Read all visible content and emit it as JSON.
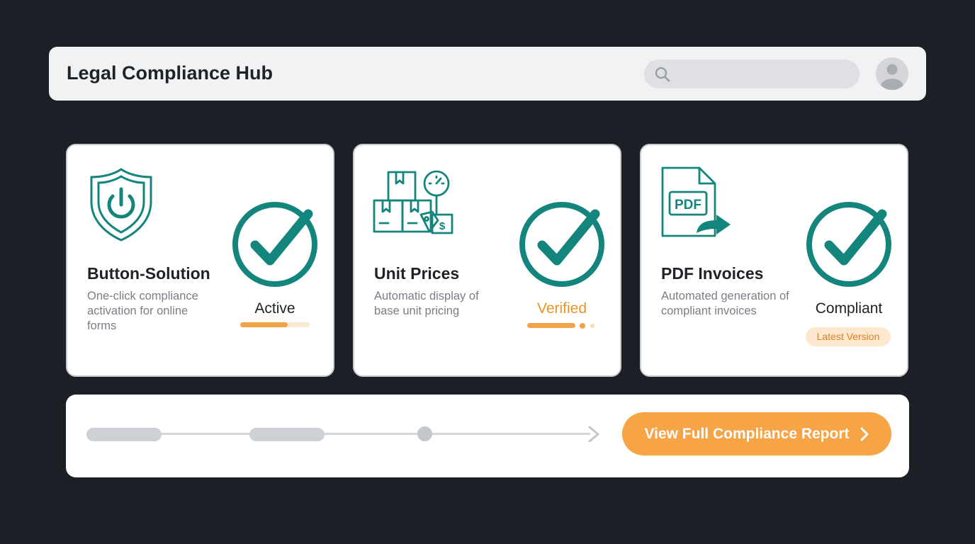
{
  "app": {
    "title": "Legal Compliance Hub"
  },
  "search": {
    "placeholder": "",
    "value": "",
    "icon": "search-icon"
  },
  "user": {
    "avatar_icon": "user-avatar-icon"
  },
  "cards": [
    {
      "title": "Button-Solution",
      "description": "One-click compliance activation for online forms",
      "status": "Active",
      "illustration_icon": "shield-power-icon",
      "status_icon": "check-circle-icon",
      "progress": 0.68
    },
    {
      "title": "Unit Prices",
      "description": "Automatic display of base unit pricing",
      "status": "Verified",
      "illustration_icon": "boxes-scale-price-icon",
      "status_icon": "check-circle-icon"
    },
    {
      "title": "PDF Invoices",
      "description": "Automated generation of compliant invoices",
      "status": "Compliant",
      "badge": "Latest Version",
      "illustration_icon": "pdf-export-icon",
      "status_icon": "check-circle-icon"
    }
  ],
  "footer": {
    "report_button": "View Full Compliance Report",
    "button_icon": "chevron-right-icon"
  },
  "colors": {
    "background": "#1c1f26",
    "teal_accent": "#13857d",
    "orange_accent": "#f6a446",
    "panel": "#f1f2f3"
  }
}
